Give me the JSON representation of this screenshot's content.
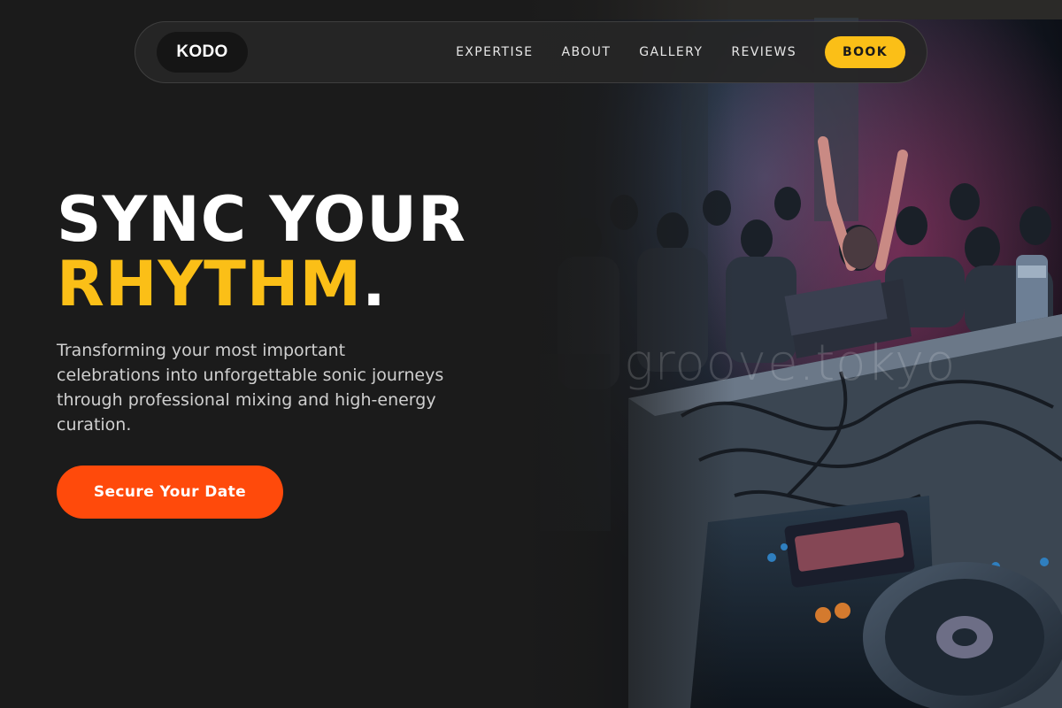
{
  "brand": {
    "logo_text": "KODO"
  },
  "nav": {
    "links": [
      {
        "label": "EXPERTISE"
      },
      {
        "label": "ABOUT"
      },
      {
        "label": "GALLERY"
      },
      {
        "label": "REVIEWS"
      }
    ],
    "book_label": "BOOK"
  },
  "hero": {
    "title_line1": "SYNC YOUR",
    "title_line2_accent": "RHYTHM",
    "title_line2_end": ".",
    "description": "Transforming your most important celebrations into unforgettable sonic journeys through professional mixing and high-energy curation.",
    "cta_label": "Secure Your Date",
    "photo_watermark": "groove.tokyo"
  },
  "colors": {
    "background": "#1b1b1b",
    "accent_yellow": "#fbbf17",
    "cta_orange": "#ff4a0b",
    "nav_bg": "#262626"
  }
}
